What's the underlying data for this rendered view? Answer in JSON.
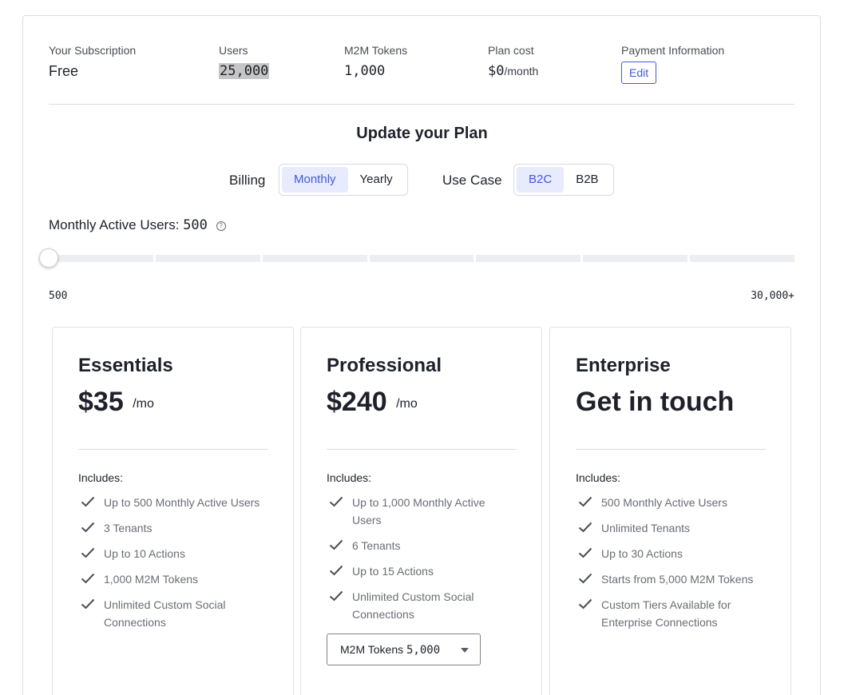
{
  "summary": {
    "subscription": {
      "label": "Your Subscription",
      "value": "Free"
    },
    "users": {
      "label": "Users",
      "value": "25,000"
    },
    "m2m": {
      "label": "M2M Tokens",
      "value": "1,000"
    },
    "plan_cost": {
      "label": "Plan cost",
      "value": "$0",
      "unit": "/month"
    },
    "payment": {
      "label": "Payment Information",
      "edit_label": "Edit"
    }
  },
  "update": {
    "title": "Update your Plan",
    "billing": {
      "label": "Billing",
      "options": [
        "Monthly",
        "Yearly"
      ],
      "selected": "Monthly"
    },
    "use_case": {
      "label": "Use Case",
      "options": [
        "B2C",
        "B2B"
      ],
      "selected": "B2C"
    }
  },
  "mau": {
    "label": "Monthly Active Users:",
    "value": "500",
    "help_icon": "question-circle-icon",
    "min_label": "500",
    "max_label": "30,000+",
    "slider_position": 0
  },
  "plans": [
    {
      "name": "Essentials",
      "price": "$35",
      "per": "/mo",
      "includes_label": "Includes:",
      "features": [
        "Up to 500 Monthly Active Users",
        "3 Tenants",
        "Up to 10 Actions",
        "1,000 M2M Tokens",
        "Unlimited Custom Social Connections"
      ]
    },
    {
      "name": "Professional",
      "price": "$240",
      "per": "/mo",
      "includes_label": "Includes:",
      "features": [
        "Up to 1,000 Monthly Active Users",
        "6 Tenants",
        "Up to 15 Actions",
        "Unlimited Custom Social Connections"
      ],
      "dropdown": {
        "label": "M2M Tokens",
        "value": "5,000"
      }
    },
    {
      "name": "Enterprise",
      "price": "Get in touch",
      "per": "",
      "includes_label": "Includes:",
      "features": [
        "500 Monthly Active Users",
        "Unlimited Tenants",
        "Up to 30 Actions",
        "Starts from 5,000 M2M Tokens",
        "Custom Tiers Available for Enterprise Connections"
      ]
    }
  ],
  "colors": {
    "accent": "#3f59e4",
    "accent_bg": "#e8ebfc",
    "text": "#1e212a",
    "muted": "#6a6d75"
  }
}
